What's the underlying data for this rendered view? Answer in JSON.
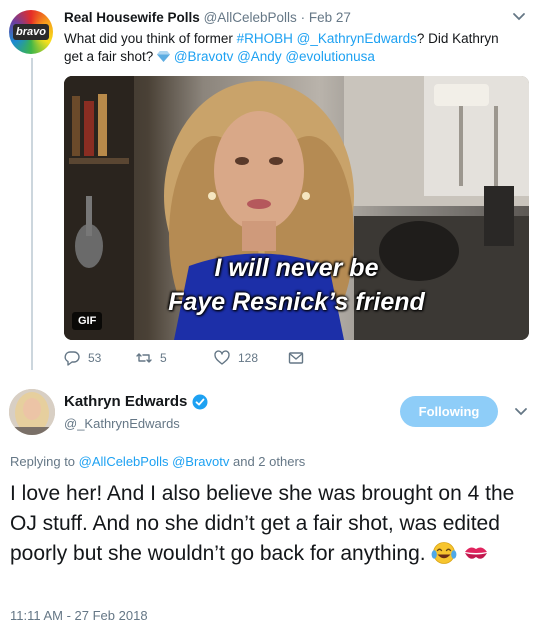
{
  "parent": {
    "name": "Real Housewife Polls",
    "handle": "@AllCelebPolls",
    "separator": "·",
    "date": "Feb 27",
    "avatar_text": "bravo",
    "text_1": "What did you think of former ",
    "hashtag": "#RHOBH",
    "mention_1": "@_KathrynEdwards",
    "text_2": "? Did Kathryn get a fair shot?",
    "mention_2": "@Bravotv",
    "mention_3": "@Andy",
    "mention_4": "@evolutionusa",
    "media": {
      "badge": "GIF",
      "caption_line1": "I will never be",
      "caption_line2": "Faye Resnick’s friend"
    },
    "actions": {
      "replies": "53",
      "retweets": "5",
      "likes": "128"
    }
  },
  "main": {
    "name": "Kathryn Edwards",
    "handle": "@_KathrynEdwards",
    "follow_label": "Following",
    "replying_prefix": "Replying to",
    "replying_mention_1": "@AllCelebPolls",
    "replying_mention_2": "@Bravotv",
    "replying_suffix": "and 2 others",
    "body": "I love her! And I also believe she was brought on 4 the OJ stuff. And no she didn’t get a fair shot, was edited poorly but she wouldn’t go back for anything.",
    "timestamp": "11:11 AM - 27 Feb 2018"
  },
  "colors": {
    "link": "#1da1f2",
    "muted": "#657786",
    "follow_button": "#8ecdf8",
    "verified": "#1da1f2"
  },
  "icons": [
    "chevron-down-icon",
    "gem-icon",
    "reply-icon",
    "retweet-icon",
    "like-icon",
    "message-icon",
    "verified-icon",
    "tears-of-joy-emoji",
    "kiss-emoji"
  ]
}
